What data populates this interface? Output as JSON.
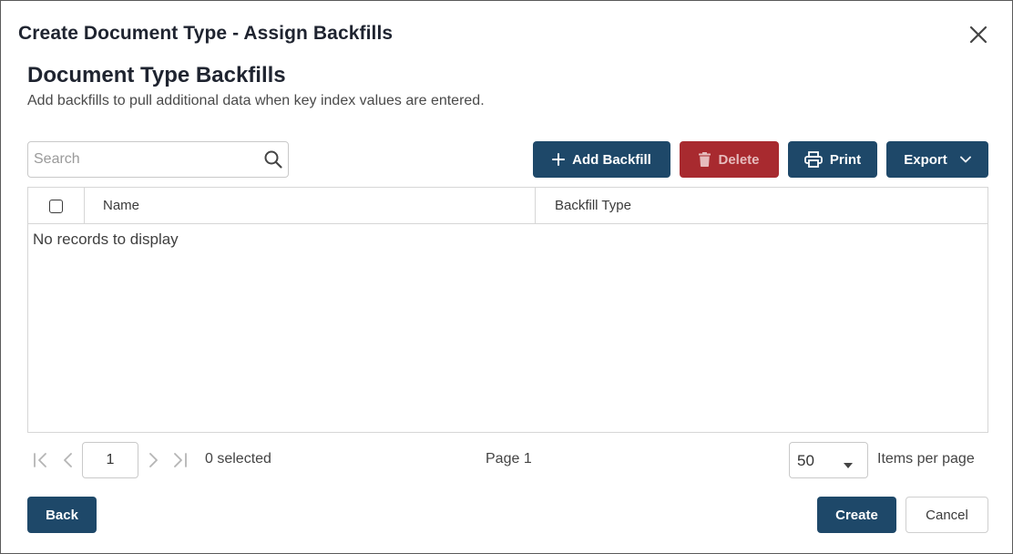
{
  "dialog": {
    "title": "Create Document Type - Assign Backfills"
  },
  "section": {
    "title": "Document Type Backfills",
    "description": "Add backfills to pull additional data when key index values are entered."
  },
  "search": {
    "placeholder": "Search",
    "value": ""
  },
  "toolbar": {
    "add_label": "Add Backfill",
    "delete_label": "Delete",
    "print_label": "Print",
    "export_label": "Export"
  },
  "grid": {
    "columns": [
      "Name",
      "Backfill Type"
    ],
    "rows": [],
    "empty_message": "No records to display"
  },
  "pager": {
    "current_page": "1",
    "selected_text": "0 selected",
    "page_text": "Page 1",
    "page_size": "50",
    "items_per_page_label": "Items per page"
  },
  "footer": {
    "back_label": "Back",
    "create_label": "Create",
    "cancel_label": "Cancel"
  },
  "colors": {
    "primary": "#1e4869",
    "danger": "#a82a2f",
    "border": "#d6d6d6"
  }
}
